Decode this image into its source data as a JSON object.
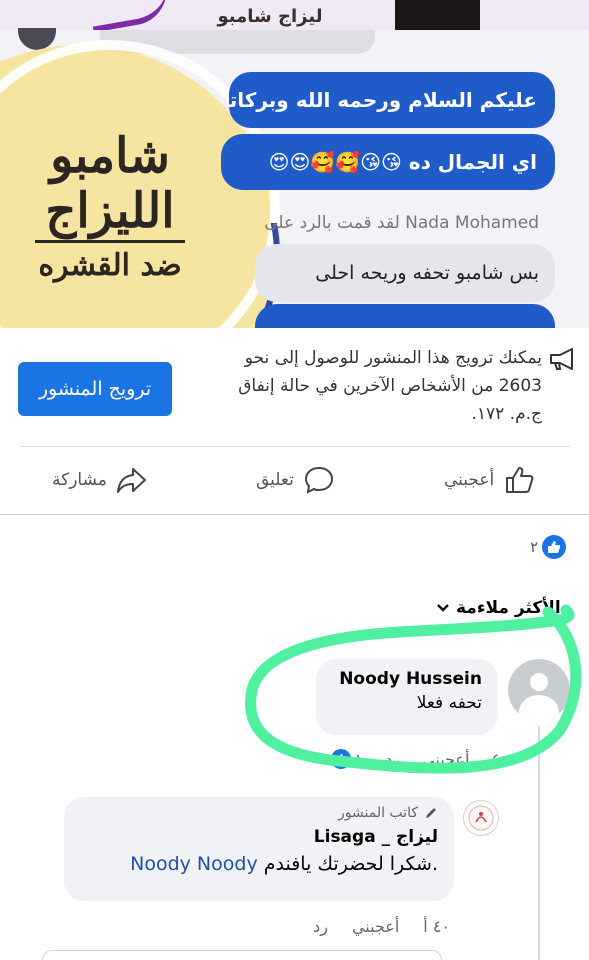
{
  "post_image": {
    "top_strip_text": "ليزاج شامبو",
    "logo": {
      "line1": "شامبو",
      "line2": "الليزاج",
      "line3": "ضد القشره"
    },
    "chat": {
      "bubble1": "عليكم السلام ورحمه الله وبركاته",
      "bubble2": "اي الجمال ده 😘😘🥰🥰😍😍",
      "reply_header": "Nada Mohamed لقد قمت بالرد على",
      "grey_bubble": "بس شامبو تحفه وريحه احلى"
    }
  },
  "boost": {
    "text": "يمكنك ترويج هذا المنشور للوصول إلى نحو 2603 من الأشخاص الآخرين في حالة إنفاق ج.م. ١٧٢.",
    "button_label": "ترويج المنشور"
  },
  "actions": {
    "like": "أعجبني",
    "comment": "تعليق",
    "share": "مشاركة"
  },
  "reactions": {
    "count": "٢"
  },
  "sort": {
    "label": "الأكثر ملاءمة"
  },
  "comments": [
    {
      "author": "Noody Hussein",
      "text": "تحفه فعلا",
      "time": "٤",
      "like": "أعجبني",
      "reply": "رد",
      "reaction_count": "١"
    },
    {
      "badge": "كاتب المنشور",
      "author": "ليزاج _ Lisaga",
      "text": ".شكرا لحضرتك يافندم",
      "mention": "Noody Noody",
      "time": "٤٠ أ",
      "like": "أعجبني",
      "reply": "رد"
    }
  ],
  "colors": {
    "brand_blue": "#1b74e4",
    "chat_blue": "#1f5bc9",
    "annotation_green": "#4ff0a0"
  }
}
